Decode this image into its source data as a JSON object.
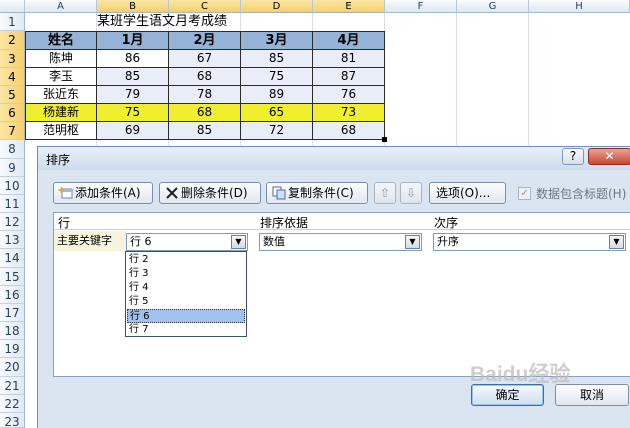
{
  "spreadsheet": {
    "column_headers": [
      "A",
      "B",
      "C",
      "D",
      "E",
      "F",
      "G",
      "H"
    ],
    "row_numbers": [
      "1",
      "2",
      "3",
      "4",
      "5",
      "6",
      "7",
      "8",
      "9",
      "10",
      "11",
      "12",
      "13",
      "14",
      "15",
      "16",
      "17",
      "18",
      "19",
      "20",
      "21",
      "22",
      "23"
    ],
    "title": "某班学生语文月考成绩",
    "table_header": [
      "姓名",
      "1月",
      "2月",
      "3月",
      "4月"
    ],
    "rows": [
      {
        "name": "陈坤",
        "values": [
          "86",
          "67",
          "85",
          "81"
        ]
      },
      {
        "name": "李玉",
        "values": [
          "85",
          "68",
          "75",
          "87"
        ]
      },
      {
        "name": "张近东",
        "values": [
          "79",
          "78",
          "89",
          "76"
        ]
      },
      {
        "name": "杨建新",
        "values": [
          "75",
          "68",
          "65",
          "73"
        ],
        "highlight": "#f0ef2e"
      },
      {
        "name": "范明枢",
        "values": [
          "69",
          "85",
          "72",
          "68"
        ]
      }
    ],
    "header_fill": "#95b3d7"
  },
  "dialog": {
    "title": "排序",
    "help_label": "?",
    "close_label": "✕",
    "toolbar": {
      "add_label": "添加条件(A)",
      "delete_label": "删除条件(D)",
      "copy_label": "复制条件(C)",
      "up_icon": "arrow-up-icon",
      "down_icon": "arrow-down-icon",
      "options_label": "选项(O)...",
      "header_checkbox_label": "数据包含标题(H)"
    },
    "columns": {
      "row": "行",
      "sort_on": "排序依据",
      "order": "次序"
    },
    "condition": {
      "key_label": "主要关键字",
      "key_value": "行 6",
      "sort_on_value": "数值",
      "order_value": "升序"
    },
    "dropdown_options": [
      "行 2",
      "行 3",
      "行 4",
      "行 5",
      "行 6",
      "行 7"
    ],
    "dropdown_selected": "行 6",
    "ok_label": "确定",
    "cancel_label": "取消"
  },
  "watermark": "Baidu经验"
}
